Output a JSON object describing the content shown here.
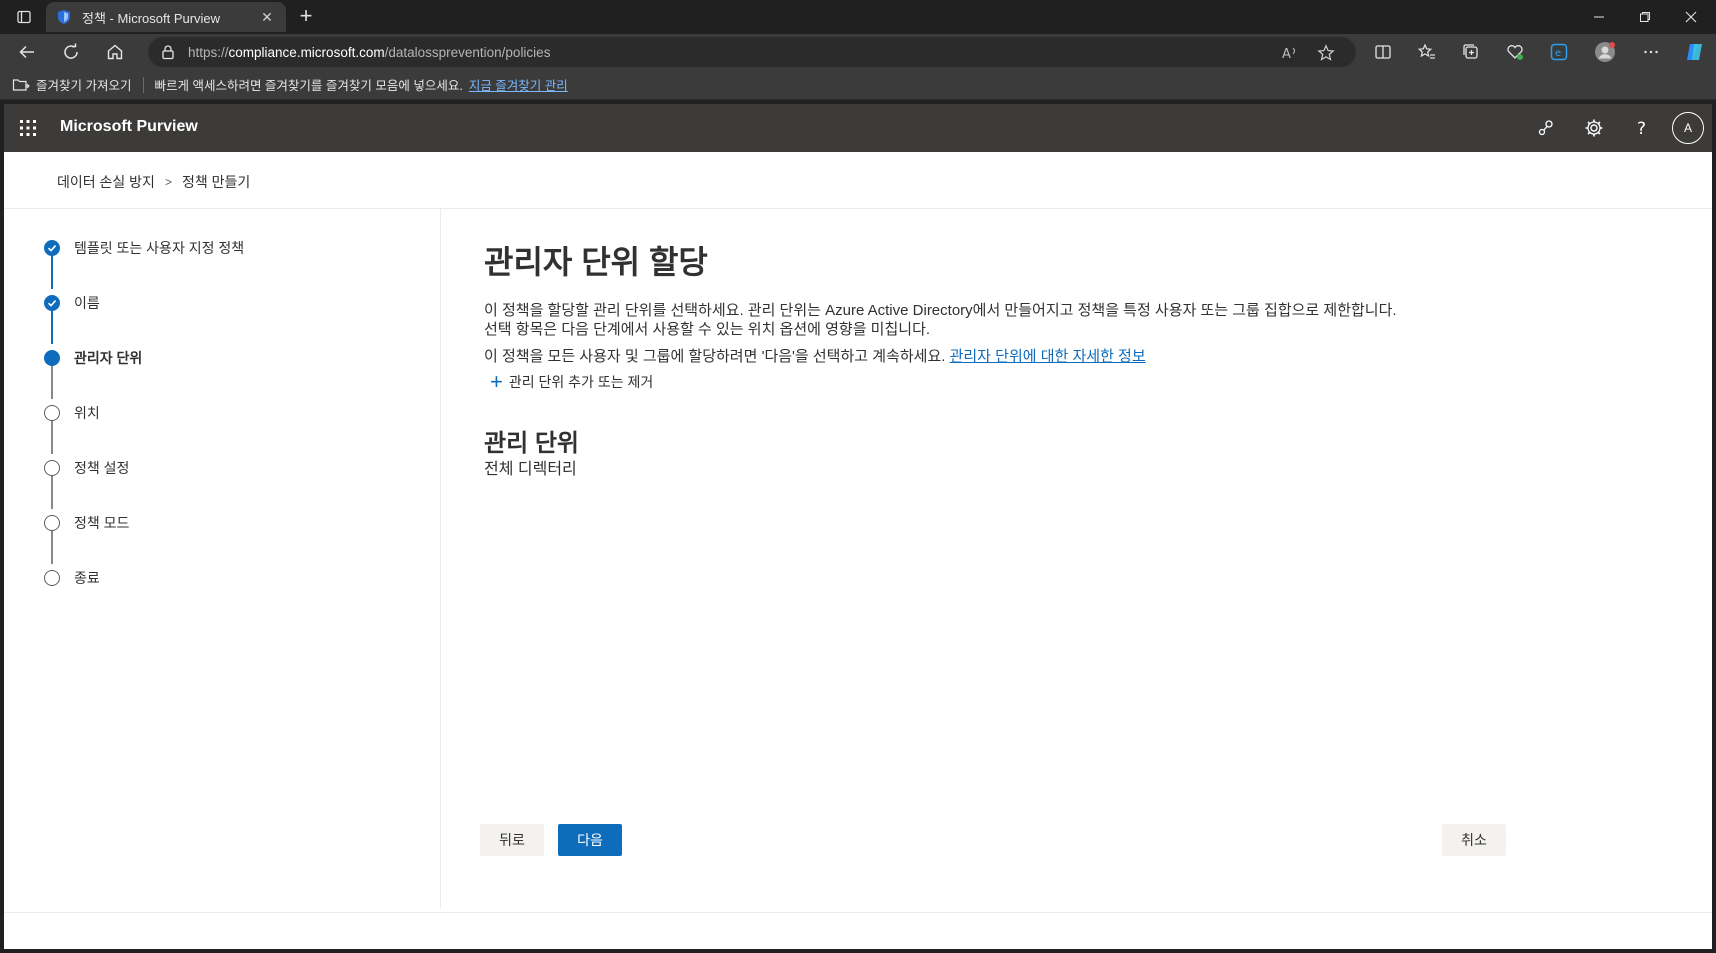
{
  "browser": {
    "tab_title": "정책 - Microsoft Purview",
    "url_prefix": "https://",
    "url_host": "compliance.microsoft.com",
    "url_path": "/datalossprevention/policies",
    "favorites_import_label": "즐겨찾기 가져오기",
    "favorites_hint": "빠르게 액세스하려면 즐겨찾기를 즐겨찾기 모음에 넣으세요.",
    "favorites_manage_link": "지금 즐겨찾기 관리"
  },
  "app": {
    "brand": "Microsoft Purview",
    "avatar_initial": "A"
  },
  "breadcrumb": [
    "데이터 손실 방지",
    "정책 만들기"
  ],
  "steps": [
    {
      "label": "템플릿 또는 사용자 지정 정책",
      "state": "done"
    },
    {
      "label": "이름",
      "state": "done"
    },
    {
      "label": "관리자 단위",
      "state": "current"
    },
    {
      "label": "위치",
      "state": "todo"
    },
    {
      "label": "정책 설정",
      "state": "todo"
    },
    {
      "label": "정책 모드",
      "state": "todo"
    },
    {
      "label": "종료",
      "state": "todo"
    }
  ],
  "main": {
    "title": "관리자 단위 할당",
    "description": "이 정책을 할당할 관리 단위를 선택하세요. 관리 단위는 Azure Active Directory에서 만들어지고 정책을 특정 사용자 또는 그룹 집합으로 제한합니다. 선택 항목은 다음 단계에서 사용할 수 있는 위치 옵션에 영향을 미칩니다.",
    "description2": "이 정책을 모든 사용자 및 그룹에 할당하려면 '다음'을 선택하고 계속하세요.",
    "learn_more_link": "관리자 단위에 대한 자세한 정보",
    "add_remove_label": "관리 단위 추가 또는 제거",
    "section_title": "관리 단위",
    "section_value": "전체 디렉터리"
  },
  "footer": {
    "back_label": "뒤로",
    "next_label": "다음",
    "cancel_label": "취소"
  },
  "colors": {
    "accent": "#0f6cbd",
    "suitebar": "#3c3b3a"
  }
}
